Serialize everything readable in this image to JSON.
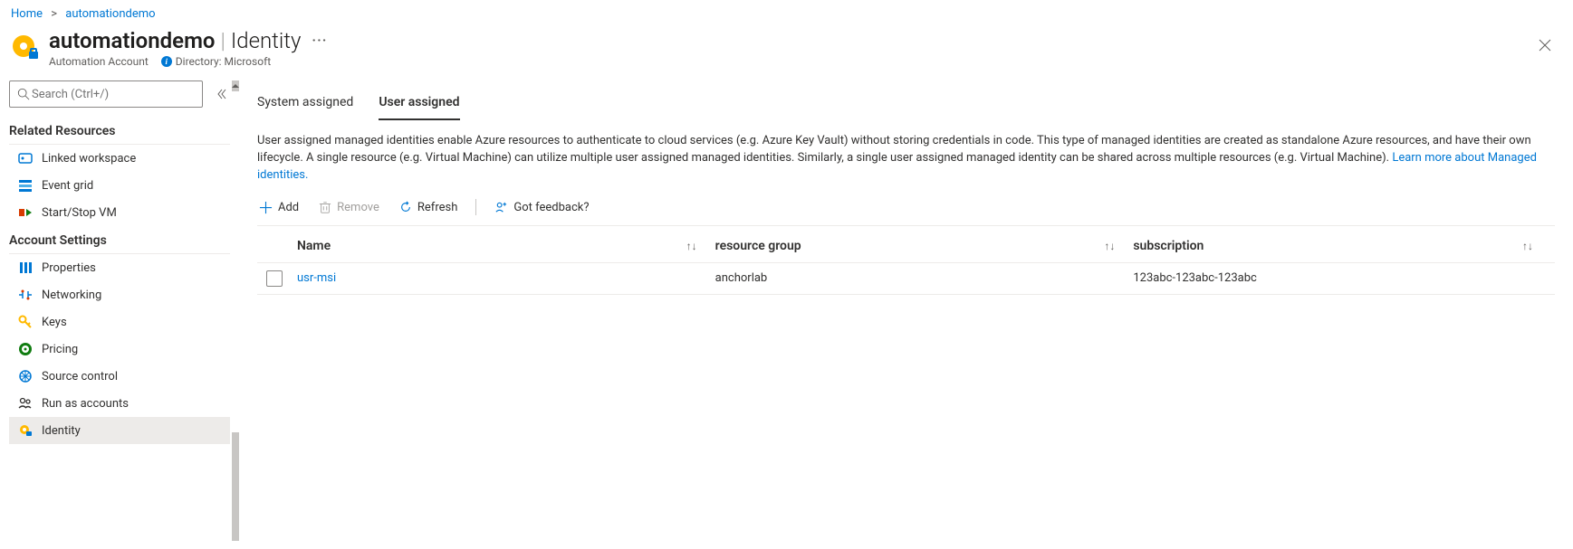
{
  "breadcrumb": {
    "home": "Home",
    "item": "automationdemo"
  },
  "header": {
    "title": "automationdemo",
    "section": "Identity",
    "type": "Automation Account",
    "directory_label": "Directory: Microsoft"
  },
  "search": {
    "placeholder": "Search (Ctrl+/)"
  },
  "sidebar": {
    "group1_header": "Related Resources",
    "group1": [
      {
        "label": "Linked workspace"
      },
      {
        "label": "Event grid"
      },
      {
        "label": "Start/Stop VM"
      }
    ],
    "group2_header": "Account Settings",
    "group2": [
      {
        "label": "Properties"
      },
      {
        "label": "Networking"
      },
      {
        "label": "Keys"
      },
      {
        "label": "Pricing"
      },
      {
        "label": "Source control"
      },
      {
        "label": "Run as accounts"
      },
      {
        "label": "Identity"
      }
    ]
  },
  "tabs": {
    "system": "System assigned",
    "user": "User assigned"
  },
  "description_text": "User assigned managed identities enable Azure resources to authenticate to cloud services (e.g. Azure Key Vault) without storing credentials in code. This type of managed identities are created as standalone Azure resources, and have their own lifecycle. A single resource (e.g. Virtual Machine) can utilize multiple user assigned managed identities. Similarly, a single user assigned managed identity can be shared across multiple resources (e.g. Virtual Machine). ",
  "learn_more": "Learn more about Managed identities.",
  "toolbar": {
    "add": "Add",
    "remove": "Remove",
    "refresh": "Refresh",
    "feedback": "Got feedback?"
  },
  "table": {
    "columns": {
      "name": "Name",
      "rg": "resource group",
      "sub": "subscription"
    },
    "rows": [
      {
        "name": "usr-msi",
        "rg": "anchorlab",
        "sub": "123abc-123abc-123abc"
      }
    ]
  }
}
